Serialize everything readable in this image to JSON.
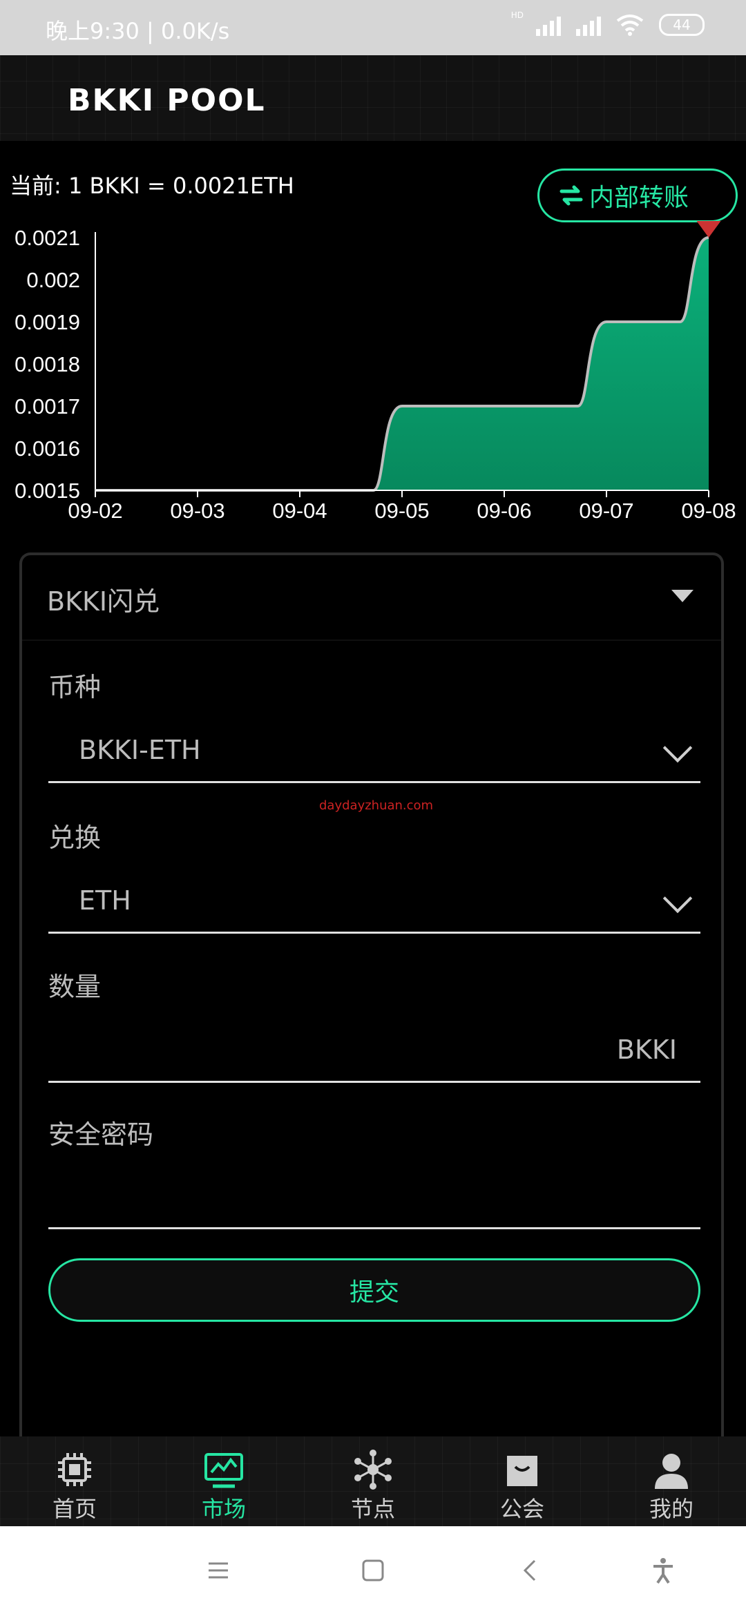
{
  "status_bar": {
    "time": "晚上9:30 | 0.0K/s",
    "hd_label": "HD",
    "battery": "44"
  },
  "header": {
    "logo": "BKKI POOL"
  },
  "rate": {
    "text": "当前: 1 BKKI = 0.0021ETH"
  },
  "transfer_button": {
    "label": "内部转账"
  },
  "chart_data": {
    "type": "area",
    "x": [
      "09-02",
      "09-03",
      "09-04",
      "09-05",
      "09-06",
      "09-07",
      "09-08"
    ],
    "values": [
      0.0015,
      0.0015,
      0.0015,
      0.0017,
      0.0017,
      0.0019,
      0.0021
    ],
    "y_ticks": [
      "0.0021",
      "0.002",
      "0.0019",
      "0.0018",
      "0.0017",
      "0.0016",
      "0.0015"
    ],
    "ylim": [
      0.0015,
      0.0021
    ],
    "pin_label": "0.0021",
    "colors": {
      "fill": "#0aa371",
      "line": "#bdbdbd",
      "pin": "#cc3333"
    }
  },
  "card": {
    "title": "BKKI闪兑",
    "coin_label": "币种",
    "coin_value": "BKKI-ETH",
    "exchange_label": "兑换",
    "exchange_value": "ETH",
    "amount_label": "数量",
    "amount_value": "",
    "amount_unit": "BKKI",
    "password_label": "安全密码",
    "password_value": "",
    "submit_label": "提交",
    "watermark": "daydayzhuan.com"
  },
  "bottom_nav": [
    {
      "label": "首页",
      "icon": "chip-icon",
      "active": false
    },
    {
      "label": "市场",
      "icon": "market-monitor-icon",
      "active": true
    },
    {
      "label": "节点",
      "icon": "node-network-icon",
      "active": false
    },
    {
      "label": "公会",
      "icon": "shopping-bag-icon",
      "active": false
    },
    {
      "label": "我的",
      "icon": "user-icon",
      "active": false
    }
  ],
  "colors": {
    "accent": "#26e6a3",
    "background": "#000000"
  }
}
